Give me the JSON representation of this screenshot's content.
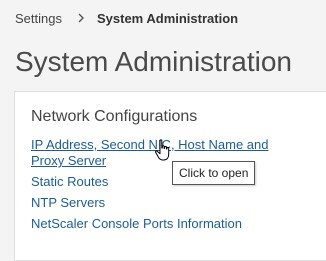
{
  "breadcrumb": {
    "parent": "Settings",
    "current": "System Administration",
    "separator_icon": "chevron-right-icon"
  },
  "page": {
    "title": "System Administration"
  },
  "network_section": {
    "title": "Network Configurations",
    "links": {
      "ip_address": "IP Address, Second NIC, Host Name and Proxy Server",
      "static_routes": "Static Routes",
      "ntp_servers": "NTP Servers",
      "console_ports": "NetScaler Console Ports Information"
    }
  },
  "tooltip": {
    "text": "Click to open"
  },
  "cursor": {
    "icon": "hand-pointer-icon"
  },
  "colors": {
    "link": "#1c5d99",
    "background": "#f4f4f4",
    "panel": "#ffffff"
  }
}
